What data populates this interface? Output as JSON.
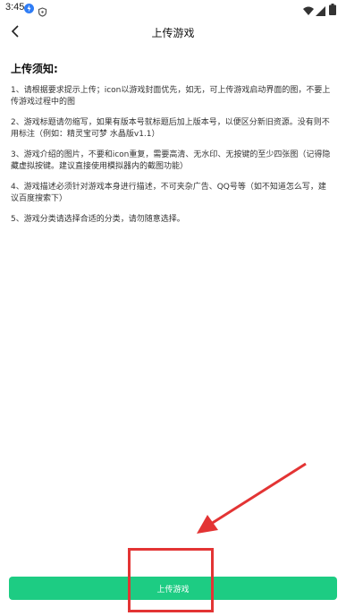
{
  "status_bar": {
    "time": "3:45",
    "icons": [
      "notification-icon",
      "shield-icon",
      "wifi-icon",
      "signal-icon",
      "battery-icon"
    ]
  },
  "app_bar": {
    "title": "上传游戏",
    "back_icon": "chevron-left-icon"
  },
  "notice": {
    "heading": "上传须知:",
    "items": [
      "1、请根据要求提示上传；icon以游戏封面优先，如无，可上传游戏启动界面的图，不要上传游戏过程中的图",
      "2、游戏标题请勿缩写，如果有版本号就标题后加上版本号，以便区分新旧资源。没有则不用标注（例如：精灵宝可梦 水晶版v1.1）",
      "3、游戏介绍的图片，不要和icon重复，需要高清、无水印、无按键的至少四张图（记得隐藏虚拟按键。建议直接使用模拟器内的截图功能）",
      "4、游戏描述必须针对游戏本身进行描述，不可夹杂广告、QQ号等（如不知道怎么写，建议百度搜索下）",
      "5、游戏分类请选择合适的分类，请勿随意选择。"
    ]
  },
  "footer": {
    "upload_button_label": "上传游戏"
  },
  "colors": {
    "button_green": "#1dcc83",
    "annotation_red": "#e33434"
  }
}
